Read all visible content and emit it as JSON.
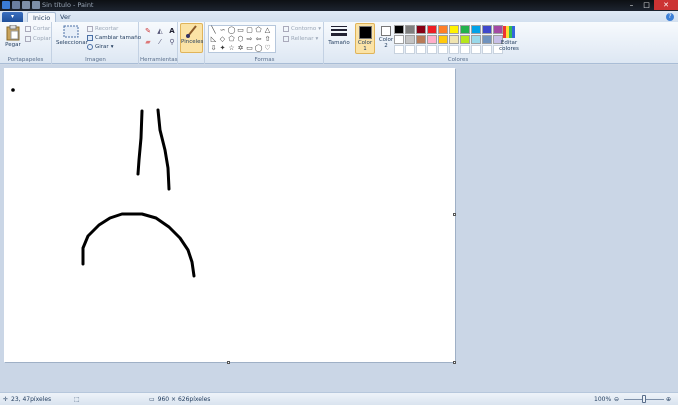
{
  "window": {
    "title": "Sin título - Paint"
  },
  "tabs": {
    "file": "▾",
    "home": "Inicio",
    "view": "Ver"
  },
  "clipboard": {
    "paste": "Pegar",
    "cut": "Cortar",
    "copy": "Copiar",
    "label": "Portapapeles"
  },
  "image": {
    "select": "Seleccionar",
    "crop": "Recortar",
    "resize": "Cambiar tamaño",
    "rotate": "Girar",
    "label": "Imagen"
  },
  "tools": {
    "label": "Herramientas"
  },
  "brushes": {
    "label": "Pinceles"
  },
  "shapes": {
    "outline": "Contorno",
    "fill": "Rellenar",
    "label": "Formas"
  },
  "size": {
    "label": "Tamaño"
  },
  "colors": {
    "color1": "Color 1",
    "color2": "Color 2",
    "edit": "Editar colores",
    "label": "Colores",
    "color1_value": "#000000",
    "color2_value": "#ffffff",
    "palette": [
      "#000000",
      "#7f7f7f",
      "#880015",
      "#ed1c24",
      "#ff7f27",
      "#fff200",
      "#22b14c",
      "#00a2e8",
      "#3f48cc",
      "#a349a4",
      "#ffffff",
      "#c3c3c3",
      "#b97a57",
      "#ffaec9",
      "#ffc90e",
      "#efe4b0",
      "#b5e61d",
      "#99d9ea",
      "#7092be",
      "#c8bfe7",
      "#ffffff",
      "#ffffff",
      "#ffffff",
      "#ffffff",
      "#ffffff",
      "#ffffff",
      "#ffffff",
      "#ffffff",
      "#ffffff",
      "#ffffff"
    ]
  },
  "status": {
    "cursor": "23, 47píxeles",
    "size": "960 × 626píxeles",
    "zoom": "100%"
  },
  "icons": {
    "minimize": "minimize-icon",
    "maximize": "maximize-icon",
    "close": "close-icon",
    "help": "help-icon"
  }
}
